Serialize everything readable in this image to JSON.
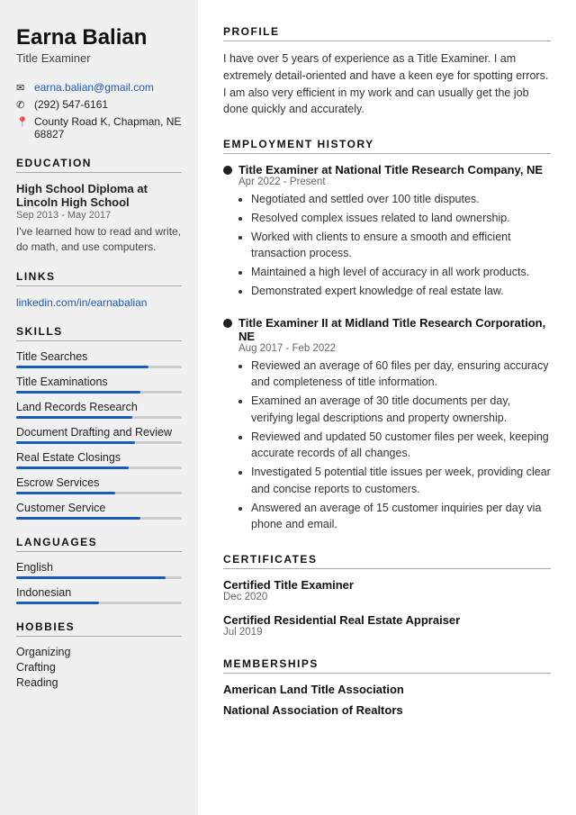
{
  "sidebar": {
    "name": "Earna Balian",
    "job_title": "Title Examiner",
    "contact": {
      "email": "earna.balian@gmail.com",
      "phone": "(292) 547-6161",
      "address": "County Road K, Chapman, NE 68827"
    },
    "education_header": "EDUCATION",
    "education": {
      "degree": "High School Diploma at Lincoln High School",
      "dates": "Sep 2013 - May 2017",
      "description": "I've learned how to read and write, do math, and use computers."
    },
    "links_header": "LINKS",
    "links": [
      {
        "label": "linkedin.com/in/earnabalian",
        "url": "#"
      }
    ],
    "skills_header": "SKILLS",
    "skills": [
      {
        "label": "Title Searches",
        "pct": 80
      },
      {
        "label": "Title Examinations",
        "pct": 75
      },
      {
        "label": "Land Records Research",
        "pct": 70
      },
      {
        "label": "Document Drafting and Review",
        "pct": 72
      },
      {
        "label": "Real Estate Closings",
        "pct": 68
      },
      {
        "label": "Escrow Services",
        "pct": 60
      },
      {
        "label": "Customer Service",
        "pct": 75
      }
    ],
    "languages_header": "LANGUAGES",
    "languages": [
      {
        "label": "English",
        "pct": 90
      },
      {
        "label": "Indonesian",
        "pct": 50
      }
    ],
    "hobbies_header": "HOBBIES",
    "hobbies": [
      "Organizing",
      "Crafting",
      "Reading"
    ]
  },
  "main": {
    "profile_header": "PROFILE",
    "profile_text": "I have over 5 years of experience as a Title Examiner. I am extremely detail-oriented and have a keen eye for spotting errors. I am also very efficient in my work and can usually get the job done quickly and accurately.",
    "employment_header": "EMPLOYMENT HISTORY",
    "jobs": [
      {
        "title": "Title Examiner at National Title Research Company, NE",
        "dates": "Apr 2022 - Present",
        "bullets": [
          "Negotiated and settled over 100 title disputes.",
          "Resolved complex issues related to land ownership.",
          "Worked with clients to ensure a smooth and efficient transaction process.",
          "Maintained a high level of accuracy in all work products.",
          "Demonstrated expert knowledge of real estate law."
        ]
      },
      {
        "title": "Title Examiner II at Midland Title Research Corporation, NE",
        "dates": "Aug 2017 - Feb 2022",
        "bullets": [
          "Reviewed an average of 60 files per day, ensuring accuracy and completeness of title information.",
          "Examined an average of 30 title documents per day, verifying legal descriptions and property ownership.",
          "Reviewed and updated 50 customer files per week, keeping accurate records of all changes.",
          "Investigated 5 potential title issues per week, providing clear and concise reports to customers.",
          "Answered an average of 15 customer inquiries per day via phone and email."
        ]
      }
    ],
    "certificates_header": "CERTIFICATES",
    "certificates": [
      {
        "name": "Certified Title Examiner",
        "date": "Dec 2020"
      },
      {
        "name": "Certified Residential Real Estate Appraiser",
        "date": "Jul 2019"
      }
    ],
    "memberships_header": "MEMBERSHIPS",
    "memberships": [
      "American Land Title Association",
      "National Association of Realtors"
    ]
  }
}
